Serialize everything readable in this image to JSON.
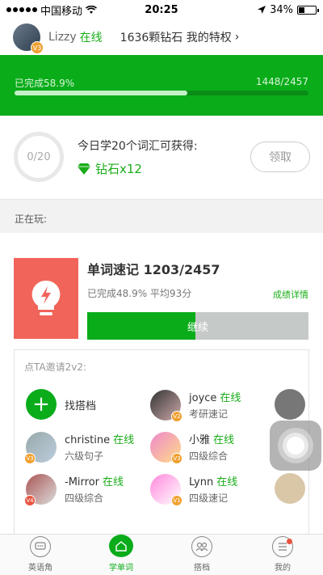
{
  "status_bar": {
    "carrier": "中国移动",
    "time": "20:25",
    "battery": "34%"
  },
  "header": {
    "username": "Lizzy",
    "online": "在线",
    "level_badge": "V3",
    "diamonds": "1636颗钻石 我的特权"
  },
  "progress": {
    "completed_label": "已完成58.9%",
    "count": "1448/2457",
    "fraction": 0.589
  },
  "daily_goal": {
    "ring_text": "0/20",
    "description": "今日学20个词汇可获得:",
    "reward": "钻石x12",
    "claim_button": "领取"
  },
  "section_label": "正在玩:",
  "current_game": {
    "title": "单词速记 1203/2457",
    "subtitle": "已完成48.9% 平均93分",
    "details_link": "成绩详情",
    "continue_button": "继续",
    "progress_fraction": 0.489
  },
  "invite": {
    "title": "点TA邀请2v2:",
    "find_partner": "找搭档",
    "mates": [
      {
        "name": "joyce",
        "status": "在线",
        "level": "考研速记",
        "badge": "V2"
      },
      {
        "name": "christine",
        "status": "在线",
        "level": "六级句子",
        "badge": "V3"
      },
      {
        "name": "小雅",
        "status": "在线",
        "level": "四级综合",
        "badge": "V3"
      },
      {
        "name": "-Mirror",
        "status": "在线",
        "level": "四级综合",
        "badge": "V4"
      },
      {
        "name": "Lynn",
        "status": "在线",
        "level": "四级速记",
        "badge": "V1"
      }
    ]
  },
  "tabs": [
    {
      "label": "英语角",
      "icon": "chat-icon"
    },
    {
      "label": "学单词",
      "icon": "home-icon"
    },
    {
      "label": "搭档",
      "icon": "partner-icon"
    },
    {
      "label": "我的",
      "icon": "menu-icon"
    }
  ]
}
